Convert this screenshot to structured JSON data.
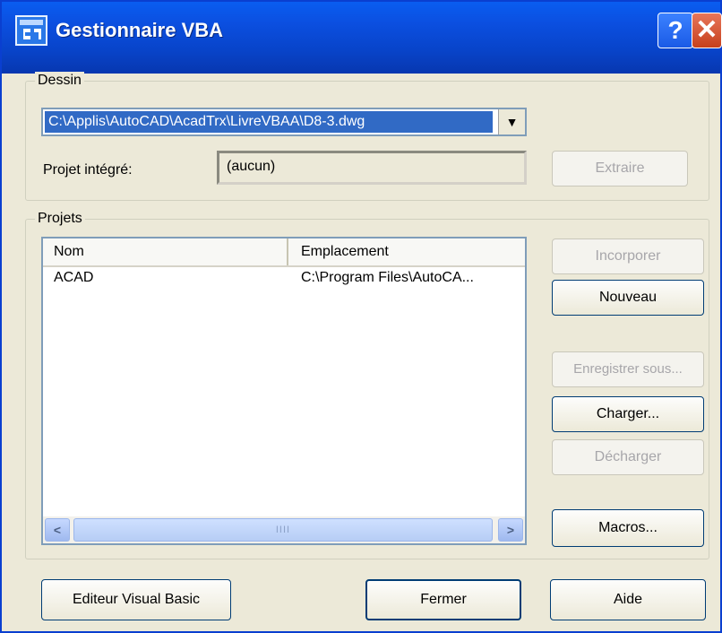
{
  "window": {
    "title": "Gestionnaire VBA",
    "help_label": "?",
    "close_label": "✕"
  },
  "dessin": {
    "group_title": "Dessin",
    "drawing_path": "C:\\Applis\\AutoCAD\\AcadTrx\\LivreVBAA\\D8-3.dwg",
    "projet_integre_label": "Projet intégré:",
    "projet_integre_value": "(aucun)",
    "extraire_label": "Extraire"
  },
  "projets": {
    "group_title": "Projets",
    "columns": [
      "Nom",
      "Emplacement"
    ],
    "rows": [
      {
        "nom": "ACAD",
        "emplacement": "C:\\Program Files\\AutoCA..."
      }
    ],
    "scrollbar_grip": "IIII",
    "buttons": {
      "incorporer": "Incorporer",
      "nouveau": "Nouveau",
      "enregistrer_sous": "Enregistrer sous...",
      "charger": "Charger...",
      "decharger": "Décharger",
      "macros": "Macros..."
    }
  },
  "footer": {
    "editeur": "Editeur Visual Basic",
    "fermer": "Fermer",
    "aide": "Aide"
  },
  "icons": {
    "title": "vba-manager-icon",
    "dropdown": "chevron-down-icon",
    "scroll_left": "chevron-left-icon",
    "scroll_right": "chevron-right-icon"
  },
  "colors": {
    "titlebar": "#0b4fe0",
    "dialog_bg": "#ece9d8",
    "selection": "#316ac5",
    "close_button": "#d84a24",
    "disabled_text": "#a7a6aa"
  }
}
